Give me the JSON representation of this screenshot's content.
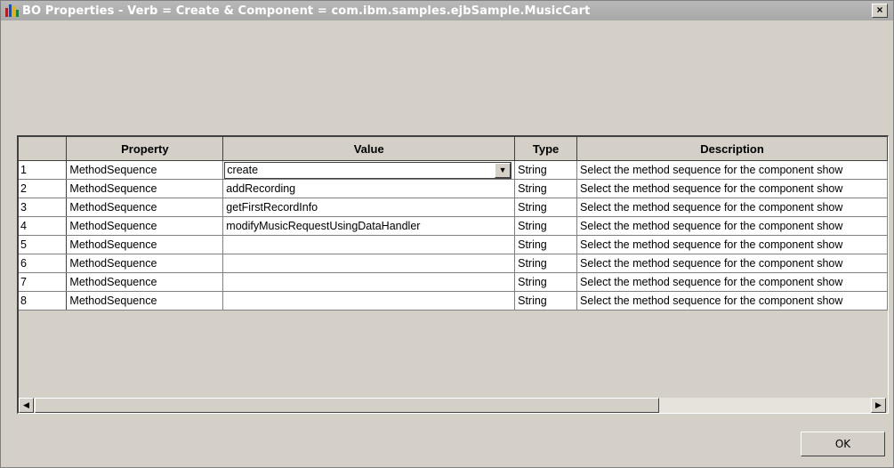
{
  "window": {
    "title": "BO Properties - Verb = Create & Component = com.ibm.samples.ejbSample.MusicCart",
    "close_label": "×"
  },
  "table": {
    "columns": [
      "Property",
      "Value",
      "Type",
      "Description"
    ],
    "rows": [
      {
        "num": "1",
        "property": "MethodSequence",
        "value": "create",
        "type": "String",
        "description": "Select the method sequence for the component show"
      },
      {
        "num": "2",
        "property": "MethodSequence",
        "value": "addRecording",
        "type": "String",
        "description": "Select the method sequence for the component show"
      },
      {
        "num": "3",
        "property": "MethodSequence",
        "value": "getFirstRecordInfo",
        "type": "String",
        "description": "Select the method sequence for the component show"
      },
      {
        "num": "4",
        "property": "MethodSequence",
        "value": "modifyMusicRequestUsingDataHandler",
        "type": "String",
        "description": "Select the method sequence for the component show"
      },
      {
        "num": "5",
        "property": "MethodSequence",
        "value": "",
        "type": "String",
        "description": "Select the method sequence for the component show"
      },
      {
        "num": "6",
        "property": "MethodSequence",
        "value": "",
        "type": "String",
        "description": "Select the method sequence for the component show"
      },
      {
        "num": "7",
        "property": "MethodSequence",
        "value": "",
        "type": "String",
        "description": "Select the method sequence for the component show"
      },
      {
        "num": "8",
        "property": "MethodSequence",
        "value": "",
        "type": "String",
        "description": "Select the method sequence for the component show"
      }
    ]
  },
  "icons": {
    "dropdown": "chevron-down-icon",
    "scroll_left": "arrow-left-icon",
    "scroll_right": "arrow-right-icon"
  },
  "buttons": {
    "ok_label": "OK"
  }
}
